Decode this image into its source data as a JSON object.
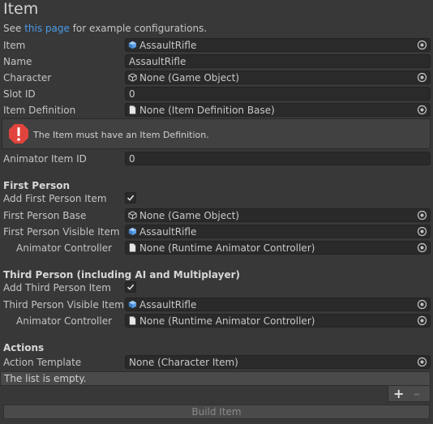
{
  "header": {
    "title": "Item",
    "see_prefix": "See ",
    "see_link": "this page",
    "see_suffix": " for example configurations."
  },
  "fields": {
    "item": {
      "label": "Item",
      "value": "AssaultRifle"
    },
    "name": {
      "label": "Name",
      "value": "AssaultRifle"
    },
    "character": {
      "label": "Character",
      "value": "None (Game Object)"
    },
    "slot_id": {
      "label": "Slot ID",
      "value": "0"
    },
    "item_definition": {
      "label": "Item Definition",
      "value": "None (Item Definition Base)"
    },
    "animator_item_id": {
      "label": "Animator Item ID",
      "value": "0"
    }
  },
  "help": {
    "message": "The Item must have an Item Definition."
  },
  "first_person": {
    "heading": "First Person",
    "add_label": "Add First Person Item",
    "add_checked": true,
    "base": {
      "label": "First Person Base",
      "value": "None (Game Object)"
    },
    "visible_item": {
      "label": "First Person Visible Item",
      "value": "AssaultRifle"
    },
    "animator_controller": {
      "label": "Animator Controller",
      "value": "None (Runtime Animator Controller)"
    }
  },
  "third_person": {
    "heading": "Third Person (including AI and Multiplayer)",
    "add_label": "Add Third Person Item",
    "add_checked": true,
    "visible_item": {
      "label": "Third Person Visible Item",
      "value": "AssaultRifle"
    },
    "animator_controller": {
      "label": "Animator Controller",
      "value": "None (Runtime Animator Controller)"
    }
  },
  "actions": {
    "heading": "Actions",
    "template": {
      "label": "Action Template",
      "value": "None (Character Item)"
    },
    "empty_text": "The list is empty.",
    "add_symbol": "+",
    "remove_symbol": "–"
  },
  "build_button": "Build Item",
  "colors": {
    "background": "#383838",
    "field": "#2a2a2a",
    "link": "#4c9be8",
    "warning": "#e0443c"
  }
}
